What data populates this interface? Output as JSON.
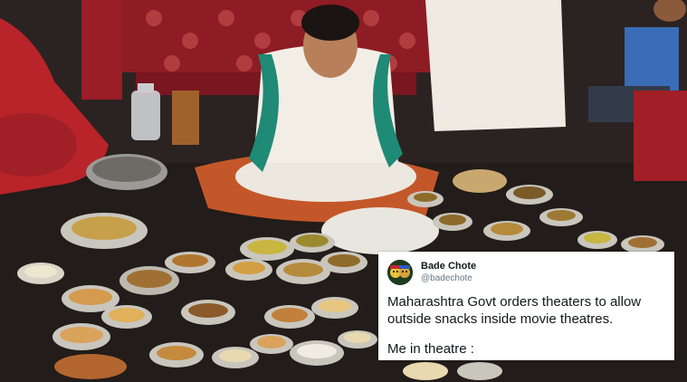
{
  "tweet": {
    "display_name": "Bade Chote",
    "handle": "@badechote",
    "line1": "Maharashtra Govt orders theaters to allow",
    "line2": "outside snacks inside movie theatres.",
    "line3": "Me in theatre :"
  },
  "colors": {
    "card_background": "#ffffff",
    "text": "#14171a",
    "handle_text": "#657786",
    "floor": "#2a2422",
    "bedspread": "#8e1c24"
  },
  "icons": {
    "avatar": "cartoon-faces-avatar"
  }
}
